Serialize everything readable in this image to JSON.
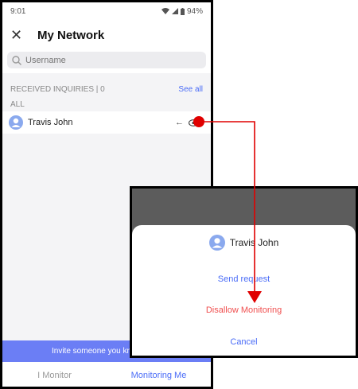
{
  "status": {
    "time": "9:01",
    "battery": "94%"
  },
  "header": {
    "title": "My Network",
    "close_icon": "close-icon"
  },
  "search": {
    "placeholder": "Username"
  },
  "received": {
    "label": "RECEIVED INQUIRIES | 0",
    "see_all": "See all"
  },
  "list": {
    "section": "ALL",
    "items": [
      {
        "name": "Travis John",
        "arrow": "←"
      }
    ]
  },
  "invite": {
    "text": "Invite someone you kno"
  },
  "tabs": {
    "monitor": "I Monitor",
    "monitoring_me": "Monitoring Me"
  },
  "modal": {
    "user": "Travis John",
    "send_request": "Send request",
    "disallow": "Disallow Monitoring",
    "cancel": "Cancel"
  },
  "colors": {
    "accent": "#4a6cf7",
    "danger": "#f05050",
    "annotation": "#e00000",
    "invite_bar": "#6b7ef5"
  }
}
